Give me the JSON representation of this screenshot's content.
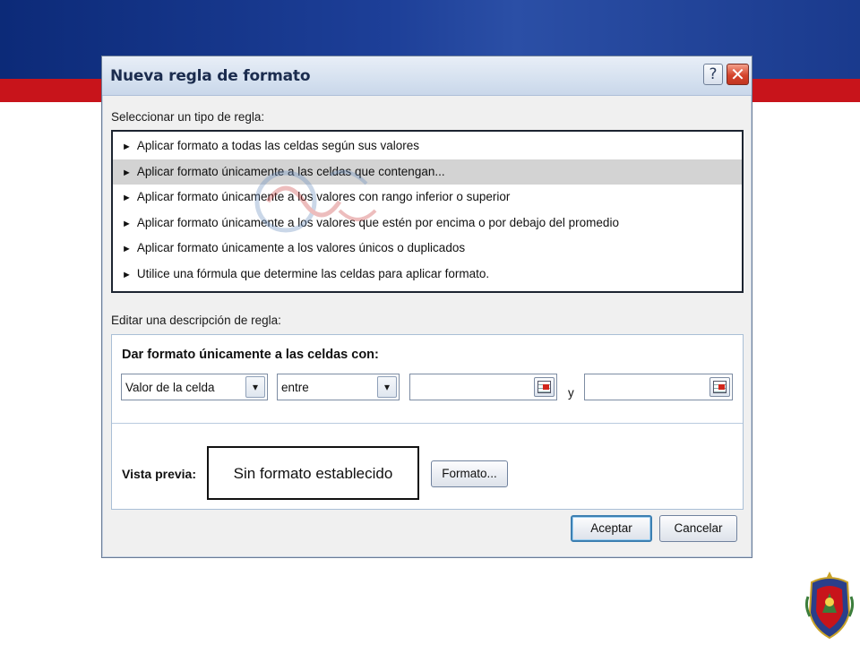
{
  "dialog": {
    "title": "Nueva regla de formato",
    "help_glyph": "?",
    "close_glyph": "✕"
  },
  "rule_type": {
    "label": "Seleccionar un tipo de regla:",
    "items": [
      {
        "label": "Aplicar formato a todas las celdas según sus valores",
        "selected": false
      },
      {
        "label": "Aplicar formato únicamente a las celdas que contengan...",
        "selected": true
      },
      {
        "label": "Aplicar formato únicamente a los valores con rango inferior o superior",
        "selected": false
      },
      {
        "label": "Aplicar formato únicamente a los valores que estén por encima o por debajo del promedio",
        "selected": false
      },
      {
        "label": "Aplicar formato únicamente a los valores únicos o duplicados",
        "selected": false
      },
      {
        "label": "Utilice una fórmula que determine las celdas para aplicar formato.",
        "selected": false
      }
    ],
    "bullet_glyph": "►"
  },
  "description": {
    "label": "Editar una descripción de regla:",
    "heading": "Dar formato únicamente a las celdas con:",
    "condition_select": "Valor de la celda",
    "operator_select": "entre",
    "value1": "",
    "and_label": "y",
    "value2": "",
    "dropdown_glyph": "▾"
  },
  "preview": {
    "label": "Vista previa:",
    "text": "Sin formato establecido",
    "format_button": "Formato..."
  },
  "footer": {
    "accept_button": "Aceptar",
    "cancel_button": "Cancelar"
  },
  "colors": {
    "banner_blue": "#1d3f98",
    "banner_red": "#c8141b",
    "selected_row": "#d3d3d3"
  }
}
